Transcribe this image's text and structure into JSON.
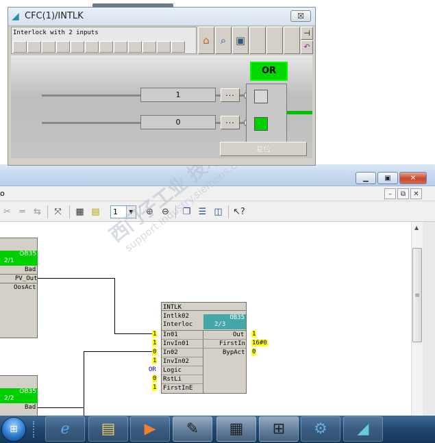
{
  "dialog": {
    "title": "CFC(1)/INTLK",
    "close_label": "☒",
    "comment": "Interlock with 2 inputs",
    "or_label": "OR",
    "input1_value": "1",
    "input2_value": "0",
    "dots_label": "...",
    "reset_label": "复位",
    "icons": [
      "home-icon",
      "search-icon",
      "device-icon",
      "pin-icon",
      "back-icon"
    ],
    "colors": {
      "or_active": "#00d800",
      "input_on": "#00d000",
      "input_off": "#d8d8d8"
    }
  },
  "editor": {
    "title_fragment": "o",
    "zoom_value": "1",
    "scroll_grip": "≡"
  },
  "blocks": {
    "upper_left": {
      "ob_label": "OB35",
      "seq_label": "2/1",
      "pins": [
        "Bad",
        "PV_Out",
        "OosAct"
      ]
    },
    "lower_left": {
      "ob_label": "OB35",
      "seq_label": "2/2",
      "pins": [
        "Bad"
      ]
    },
    "intlk": {
      "type": "INTLK",
      "instance": "Intlk02",
      "comment": "Interloc",
      "ob_label": "OB35",
      "seq_label": "2/3",
      "inputs": [
        {
          "name": "In01",
          "value": "1"
        },
        {
          "name": "InvIn01",
          "value": "1"
        },
        {
          "name": "In02",
          "value": "0"
        },
        {
          "name": "InvIn02",
          "value": "1"
        },
        {
          "name": "Logic",
          "value": "OR"
        },
        {
          "name": "RstLi",
          "value": "0"
        },
        {
          "name": "FirstInE",
          "value": "1"
        }
      ],
      "outputs": [
        {
          "name": "Out",
          "value": "1"
        },
        {
          "name": "FirstIn",
          "value": "16#0"
        },
        {
          "name": "BypAct",
          "value": "0"
        }
      ]
    }
  },
  "watermark": {
    "line1": "西门子工业 技术论坛",
    "line2": "support.industry.siemens.com/cs"
  }
}
